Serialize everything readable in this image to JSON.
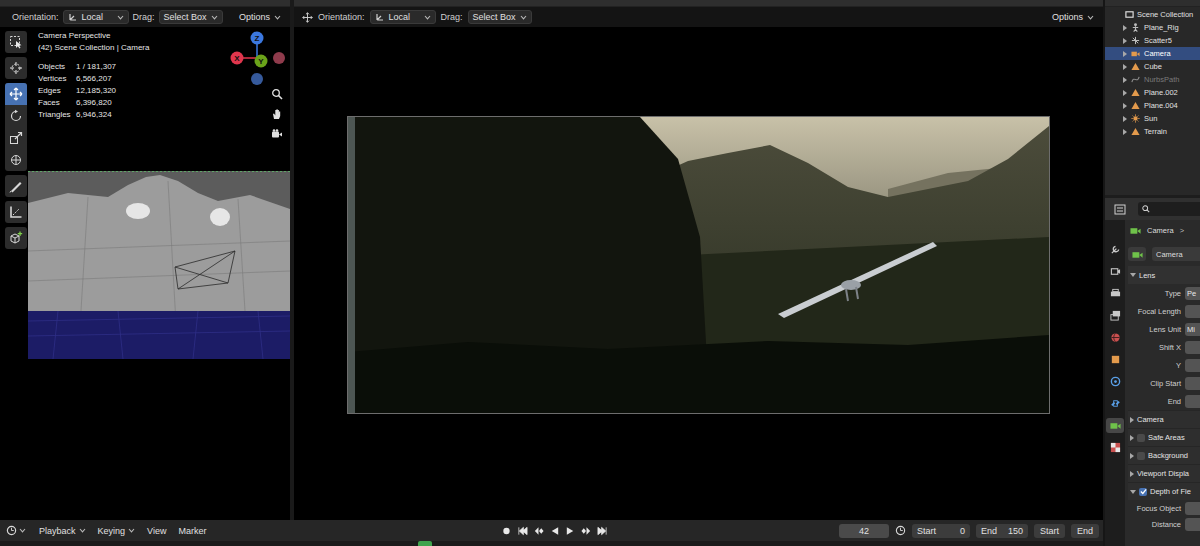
{
  "viewport_left": {
    "header": {
      "orientation_label": "Orientation:",
      "orientation": "Local",
      "drag_label": "Drag:",
      "drag": "Select Box",
      "options": "Options"
    },
    "tool_groups": [
      [
        {
          "kind": "select",
          "selected": false
        }
      ],
      [
        {
          "kind": "cursor",
          "selected": false
        }
      ],
      [
        {
          "kind": "move",
          "selected": true
        },
        {
          "kind": "rotate",
          "selected": false
        },
        {
          "kind": "scale",
          "selected": false
        },
        {
          "kind": "transform",
          "selected": false
        }
      ],
      [
        {
          "kind": "annotate",
          "selected": false
        }
      ],
      [
        {
          "kind": "measure",
          "selected": false
        }
      ],
      [
        {
          "kind": "add-cube",
          "selected": false
        }
      ]
    ],
    "overlay": {
      "title": "Camera Perspective",
      "context": "(42) Scene Collection | Camera",
      "stats": [
        {
          "label": "Objects",
          "value": "1 / 181,307"
        },
        {
          "label": "Vertices",
          "value": "6,566,207"
        },
        {
          "label": "Edges",
          "value": "12,185,320"
        },
        {
          "label": "Faces",
          "value": "6,396,820"
        },
        {
          "label": "Triangles",
          "value": "6,946,324"
        }
      ]
    },
    "axes": [
      {
        "label": "Z",
        "color": "#3b78e0"
      },
      {
        "label": "X",
        "color": "#e0364d"
      },
      {
        "label": "Y",
        "color": "#6ba31a"
      }
    ],
    "negative_axes": [
      {
        "color": "#8f3b4c"
      },
      {
        "color": "#365a9c"
      }
    ],
    "nav_buttons": [
      {
        "kind": "zoom"
      },
      {
        "kind": "pan"
      },
      {
        "kind": "camera"
      }
    ]
  },
  "viewport_main": {
    "header": {
      "orientation_label": "Orientation:",
      "orientation": "Local",
      "drag_label": "Drag:",
      "drag": "Select Box",
      "options": "Options"
    }
  },
  "outliner": {
    "root": "Scene Collection",
    "items": [
      {
        "name": "Plane_Rig",
        "kind": "armature",
        "selected": false,
        "disabled": false
      },
      {
        "name": "Scatter5",
        "kind": "empty",
        "selected": false,
        "disabled": false
      },
      {
        "name": "Camera",
        "kind": "camera",
        "selected": true,
        "disabled": false
      },
      {
        "name": "Cube",
        "kind": "mesh",
        "selected": false,
        "disabled": false
      },
      {
        "name": "NurbsPath",
        "kind": "curve",
        "selected": false,
        "disabled": true
      },
      {
        "name": "Plane.002",
        "kind": "mesh",
        "selected": false,
        "disabled": false
      },
      {
        "name": "Plane.004",
        "kind": "mesh",
        "selected": false,
        "disabled": false
      },
      {
        "name": "Sun",
        "kind": "light",
        "selected": false,
        "disabled": false
      },
      {
        "name": "Terrain",
        "kind": "mesh",
        "selected": false,
        "disabled": false
      }
    ]
  },
  "properties": {
    "tabs": [
      {
        "kind": "tool",
        "selected": false
      },
      {
        "kind": "render",
        "selected": false
      },
      {
        "kind": "output",
        "selected": false
      },
      {
        "kind": "view-layer",
        "selected": false
      },
      {
        "kind": "world",
        "selected": false
      },
      {
        "kind": "object",
        "selected": false
      },
      {
        "kind": "physics",
        "selected": false
      },
      {
        "kind": "constraints",
        "selected": false
      },
      {
        "kind": "data",
        "selected": true
      },
      {
        "kind": "texture",
        "selected": false
      }
    ],
    "breadcrumb": {
      "label": "Camera",
      "separator": ">"
    },
    "datablock": "Camera",
    "lens": {
      "title": "Lens",
      "expanded": true,
      "fields": [
        {
          "label": "Type",
          "value": "Pe"
        },
        {
          "label": "Focal Length"
        },
        {
          "label": "Lens Unit",
          "value": "Mi"
        },
        {
          "label": "Shift X"
        },
        {
          "label": "Y"
        },
        {
          "label": "Clip Start"
        },
        {
          "label": "End"
        }
      ]
    },
    "panels": [
      {
        "title": "Camera",
        "kind": "plain",
        "expanded": false
      },
      {
        "title": "Safe Areas",
        "kind": "checkbox",
        "checked": false,
        "expanded": false
      },
      {
        "title": "Background",
        "kind": "checkbox",
        "checked": false,
        "expanded": false
      },
      {
        "title": "Viewport Displa",
        "kind": "plain",
        "expanded": false
      },
      {
        "title": "Depth of Fie",
        "kind": "checkbox",
        "checked": true,
        "expanded": true
      }
    ],
    "dof_fields": [
      {
        "label": "Focus Object"
      },
      {
        "label": "Distance"
      }
    ]
  },
  "timeline": {
    "menus": [
      "Playback",
      "Keying",
      "View",
      "Marker"
    ],
    "transport": [
      {
        "kind": "record"
      },
      {
        "kind": "jump-start"
      },
      {
        "kind": "key-prev"
      },
      {
        "kind": "play-reverse"
      },
      {
        "kind": "play"
      },
      {
        "kind": "key-next"
      },
      {
        "kind": "jump-end"
      }
    ],
    "frame": "42",
    "start_label": "Start",
    "start": "0",
    "end_label": "End",
    "end": "150",
    "buttons": [
      "Start",
      "End"
    ]
  }
}
